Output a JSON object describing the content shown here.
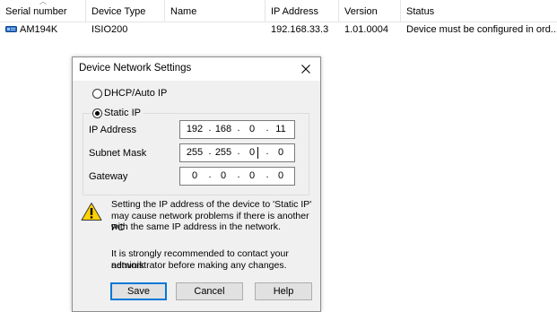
{
  "list": {
    "columns": [
      "Serial number",
      "Device Type",
      "Name",
      "IP Address",
      "Version",
      "Status"
    ],
    "rows": [
      {
        "serial": "AM194K",
        "device_type": "ISIO200",
        "name": "",
        "ip_address": "192.168.33.3",
        "version": "1.01.0004",
        "status": "Device must be configured in ord..."
      }
    ]
  },
  "dialog": {
    "title": "Device Network Settings",
    "dhcp_label": "DHCP/Auto IP",
    "static_label": "Static IP",
    "mode": "static",
    "fields": {
      "ip": {
        "label": "IP Address",
        "octets": [
          "192",
          "168",
          "0",
          "11"
        ]
      },
      "mask": {
        "label": "Subnet Mask",
        "octets": [
          "255",
          "255",
          "0",
          "0"
        ]
      },
      "gateway": {
        "label": "Gateway",
        "octets": [
          "0",
          "0",
          "0",
          "0"
        ]
      }
    },
    "warning_line1": "Setting the IP address of the device to 'Static IP'",
    "warning_line2": "may cause network problems if there is another PC",
    "warning_line3": "with the same IP address in the network.",
    "advice_line1": "It is strongly recommended to contact your network",
    "advice_line2": "administrator before making any changes.",
    "buttons": {
      "save": "Save",
      "cancel": "Cancel",
      "help": "Help"
    }
  },
  "colors": {
    "device_icon": "#2a6cc4",
    "warning_fill": "#ffd200",
    "default_button_border": "#0078d7"
  },
  "icons": {
    "device": "device-icon",
    "close": "close-icon",
    "warning": "warning-icon",
    "sort": "sort-up-icon"
  }
}
